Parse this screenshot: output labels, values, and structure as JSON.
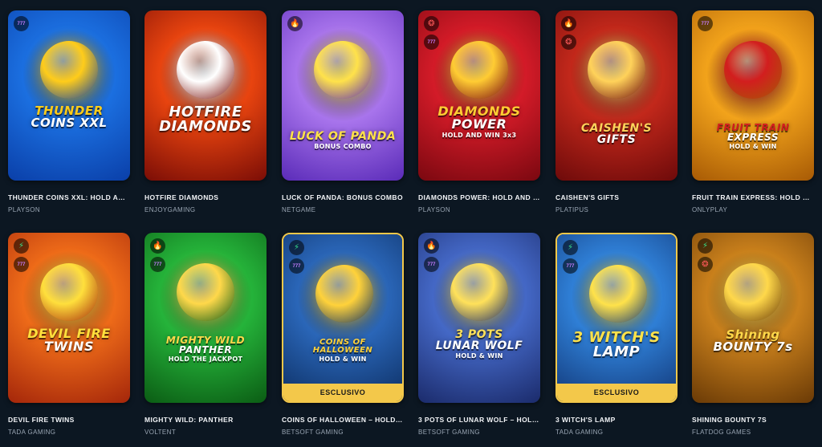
{
  "games": [
    {
      "title": "THUNDER COINS XXL: HOLD AN…",
      "provider": "PLAYSON",
      "logo": [
        "THUNDER",
        "COINS XXL"
      ],
      "logo_sub": "",
      "exclusive": false,
      "badges": [
        "jackpot-icon"
      ],
      "colors": [
        "#0a3fa8",
        "#1b6fe0",
        "#ffcc1a"
      ]
    },
    {
      "title": "HOTFIRE DIAMONDS",
      "provider": "ENJOYGAMING",
      "logo": [
        "HOTFIRE",
        "DIAMONDS"
      ],
      "logo_sub": "",
      "exclusive": false,
      "badges": [],
      "colors": [
        "#7a0d06",
        "#e8440f",
        "#ffffff"
      ]
    },
    {
      "title": "LUCK OF PANDA: BONUS COMBO",
      "provider": "NETGAME",
      "logo": [
        "LUCK OF PANDA"
      ],
      "logo_sub": "BONUS COMBO",
      "exclusive": false,
      "badges": [
        "fire-icon"
      ],
      "colors": [
        "#5a2bb8",
        "#a874ec",
        "#ffe24a"
      ]
    },
    {
      "title": "DIAMONDS POWER: HOLD AND …",
      "provider": "PLAYSON",
      "logo": [
        "DIAMONDS",
        "POWER"
      ],
      "logo_sub": "HOLD AND WIN 3x3",
      "exclusive": false,
      "badges": [
        "drops-icon",
        "jackpot-icon"
      ],
      "colors": [
        "#7a0810",
        "#d31b28",
        "#ffcc33"
      ]
    },
    {
      "title": "CAISHEN'S GIFTS",
      "provider": "PLATIPUS",
      "logo": [
        "CAISHEN'S",
        "GIFTS"
      ],
      "logo_sub": "",
      "exclusive": false,
      "badges": [
        "fire-icon",
        "drops-icon"
      ],
      "colors": [
        "#6d0a0a",
        "#c2281b",
        "#ffd25a"
      ]
    },
    {
      "title": "FRUIT TRAIN EXPRESS: HOLD &…",
      "provider": "ONLYPLAY",
      "logo": [
        "FRUIT TRAIN",
        "EXPRESS"
      ],
      "logo_sub": "HOLD & WIN",
      "exclusive": false,
      "badges": [
        "jackpot-icon"
      ],
      "colors": [
        "#a75a05",
        "#f2a31b",
        "#d21e1e"
      ]
    },
    {
      "title": "DEVIL FIRE TWINS",
      "provider": "TADA GAMING",
      "logo": [
        "DEVIL FIRE",
        "TWINS"
      ],
      "logo_sub": "",
      "exclusive": false,
      "badges": [
        "bolt-icon",
        "jackpot-icon"
      ],
      "colors": [
        "#a4260a",
        "#ee6b19",
        "#ffdf3c"
      ]
    },
    {
      "title": "MIGHTY WILD: PANTHER",
      "provider": "VOLTENT",
      "logo": [
        "MIGHTY WILD",
        "PANTHER"
      ],
      "logo_sub": "HOLD THE JACKPOT",
      "exclusive": false,
      "badges": [
        "fire-icon",
        "jackpot-icon"
      ],
      "colors": [
        "#0b5c14",
        "#25b33a",
        "#ffd84a"
      ]
    },
    {
      "title": "COINS OF HALLOWEEN – HOLD …",
      "provider": "BETSOFT GAMING",
      "logo": [
        "COINS OF HALLOWEEN"
      ],
      "logo_sub": "HOLD & WIN",
      "exclusive": true,
      "exclusive_label": "ESCLUSIVO",
      "badges": [
        "bolt-icon",
        "jackpot-icon"
      ],
      "colors": [
        "#0d2f63",
        "#2a66b8",
        "#ffd23a"
      ]
    },
    {
      "title": "3 POTS OF LUNAR WOLF – HOLD…",
      "provider": "BETSOFT GAMING",
      "logo": [
        "3 POTS",
        "LUNAR WOLF"
      ],
      "logo_sub": "HOLD & WIN",
      "exclusive": false,
      "badges": [
        "fire-icon",
        "jackpot-icon"
      ],
      "colors": [
        "#1b2b6b",
        "#4468c6",
        "#ffe15a"
      ]
    },
    {
      "title": "3 WITCH'S LAMP",
      "provider": "TADA GAMING",
      "logo": [
        "3 WITCH'S",
        "LAMP"
      ],
      "logo_sub": "",
      "exclusive": true,
      "exclusive_label": "ESCLUSIVO",
      "badges": [
        "bolt-icon",
        "jackpot-icon"
      ],
      "colors": [
        "#123878",
        "#2f7fd6",
        "#ffe24a"
      ]
    },
    {
      "title": "SHINING BOUNTY 7S",
      "provider": "FLATDOG GAMES",
      "logo": [
        "Shining",
        "BOUNTY 7s"
      ],
      "logo_sub": "",
      "exclusive": false,
      "badges": [
        "bolt-icon",
        "drops-icon"
      ],
      "colors": [
        "#6a3a06",
        "#c9801c",
        "#ffd84a"
      ]
    }
  ],
  "icons": {
    "jackpot-icon": "777",
    "fire-icon": "🔥",
    "bolt-icon": "⚡",
    "drops-icon": "❂"
  }
}
